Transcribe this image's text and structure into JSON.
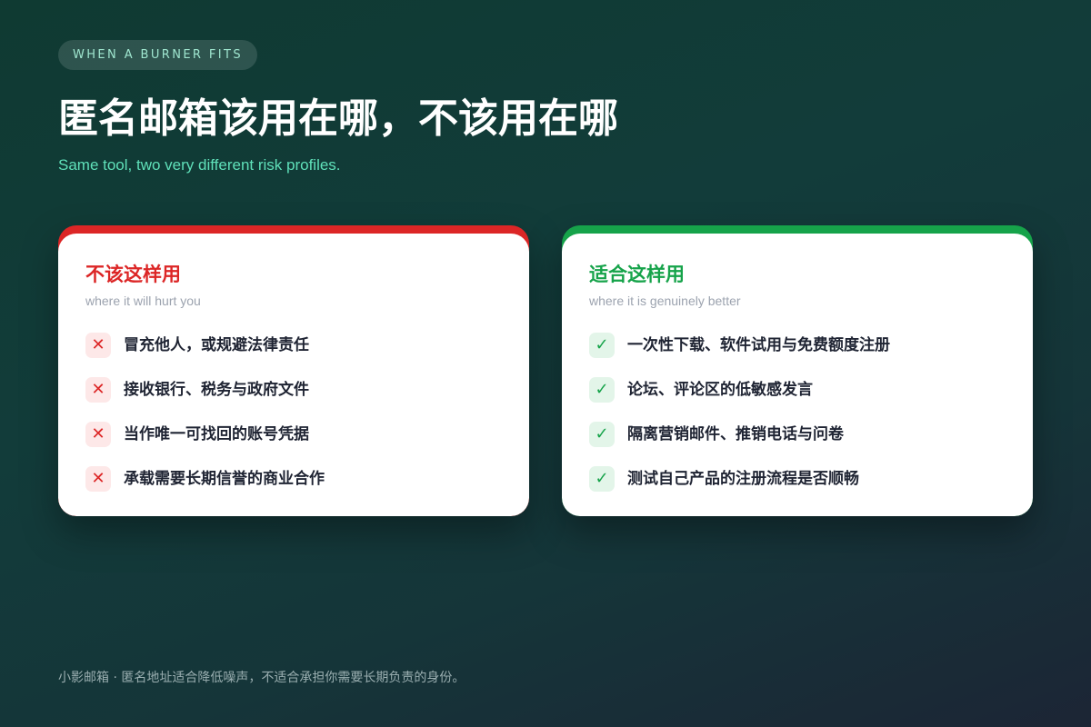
{
  "header": {
    "eyebrow": "WHEN A BURNER FITS",
    "title": "匿名邮箱该用在哪，不该用在哪",
    "subtitle": "Same tool, two very different risk profiles."
  },
  "bad_card": {
    "heading": "不该这样用",
    "subheading": "where it will hurt you",
    "mark": "✕",
    "accent_color": "#dc2626",
    "items": [
      "冒充他人，或规避法律责任",
      "接收银行、税务与政府文件",
      "当作唯一可找回的账号凭据",
      "承载需要长期信誉的商业合作"
    ]
  },
  "good_card": {
    "heading": "适合这样用",
    "subheading": "where it is genuinely better",
    "mark": "✓",
    "accent_color": "#16a34a",
    "items": [
      "一次性下载、软件试用与免费额度注册",
      "论坛、评论区的低敏感发言",
      "隔离营销邮件、推销电话与问卷",
      "测试自己产品的注册流程是否顺畅"
    ]
  },
  "footer": {
    "text": "小影邮箱 · 匿名地址适合降低噪声，不适合承担你需要长期负责的身份。"
  }
}
